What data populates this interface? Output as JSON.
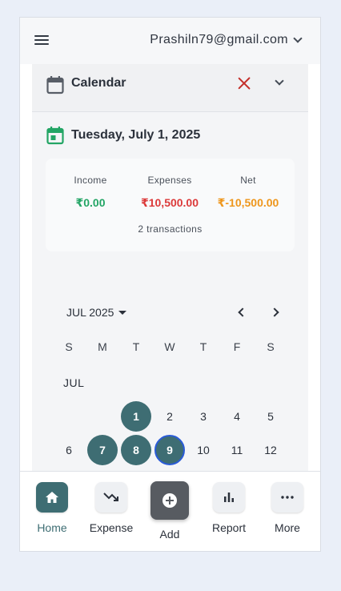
{
  "header": {
    "account_email": "Prashiln79@gmail.com"
  },
  "calendar_section": {
    "title": "Calendar"
  },
  "day_summary": {
    "date_title": "Tuesday, July 1, 2025",
    "income_label": "Income",
    "income_value": "₹0.00",
    "expenses_label": "Expenses",
    "expenses_value": "₹10,500.00",
    "net_label": "Net",
    "net_value": "₹-10,500.00",
    "transactions": "2 transactions"
  },
  "month_view": {
    "month_selector": "JUL 2025",
    "month_label": "JUL",
    "weekdays": [
      "S",
      "M",
      "T",
      "W",
      "T",
      "F",
      "S"
    ],
    "week1": [
      "1",
      "2",
      "3",
      "4",
      "5"
    ],
    "week2": [
      "6",
      "7",
      "8",
      "9",
      "10",
      "11",
      "12"
    ],
    "days_with_transactions": [
      "1",
      "7",
      "8",
      "9"
    ],
    "selected_day": "9"
  },
  "bottom_nav": {
    "home": "Home",
    "expense": "Expense",
    "add": "Add",
    "report": "Report",
    "more": "More"
  },
  "colors": {
    "accent": "#3e6d73",
    "income": "#23a565",
    "expense": "#dc3a3a",
    "net": "#ee961c",
    "close": "#c4302b"
  },
  "icons": {
    "menu": "hamburger-menu-icon",
    "calendar": "calendar-icon",
    "date": "calendar-event-icon",
    "close": "close-icon",
    "home": "home-icon",
    "expense": "trending-down-icon",
    "add": "add-circle-icon",
    "report": "bar-chart-icon",
    "more": "more-horizontal-icon"
  }
}
